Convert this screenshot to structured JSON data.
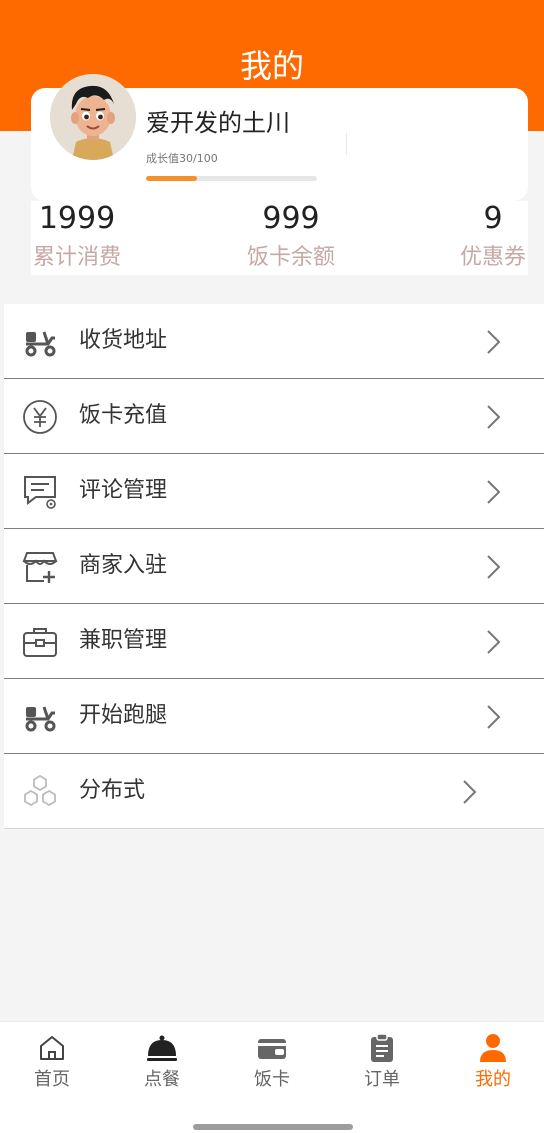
{
  "header": {
    "title": "我的"
  },
  "profile": {
    "name": "爱开发的土川",
    "growth_label": "成长值30/100",
    "growth_progress": 0.3
  },
  "stats": [
    {
      "value": "1999",
      "label": "累计消费"
    },
    {
      "value": "999",
      "label": "饭卡余额"
    },
    {
      "value": "9",
      "label": "优惠券"
    }
  ],
  "menu": [
    {
      "label": "收货地址",
      "icon": "scooter-icon"
    },
    {
      "label": "饭卡充值",
      "icon": "yen-coin-icon"
    },
    {
      "label": "评论管理",
      "icon": "comment-settings-icon"
    },
    {
      "label": "商家入驻",
      "icon": "store-add-icon"
    },
    {
      "label": "兼职管理",
      "icon": "briefcase-icon"
    },
    {
      "label": "开始跑腿",
      "icon": "scooter-icon"
    },
    {
      "label": "分布式",
      "icon": "hexagons-icon"
    }
  ],
  "tabs": [
    {
      "label": "首页",
      "icon": "home-icon"
    },
    {
      "label": "点餐",
      "icon": "food-cloche-icon"
    },
    {
      "label": "饭卡",
      "icon": "wallet-card-icon"
    },
    {
      "label": "订单",
      "icon": "clipboard-icon"
    },
    {
      "label": "我的",
      "icon": "user-icon",
      "active": true
    }
  ],
  "colors": {
    "accent": "#ff6a00",
    "progress": "#f5912b",
    "stat_label": "#c6a9a4"
  }
}
